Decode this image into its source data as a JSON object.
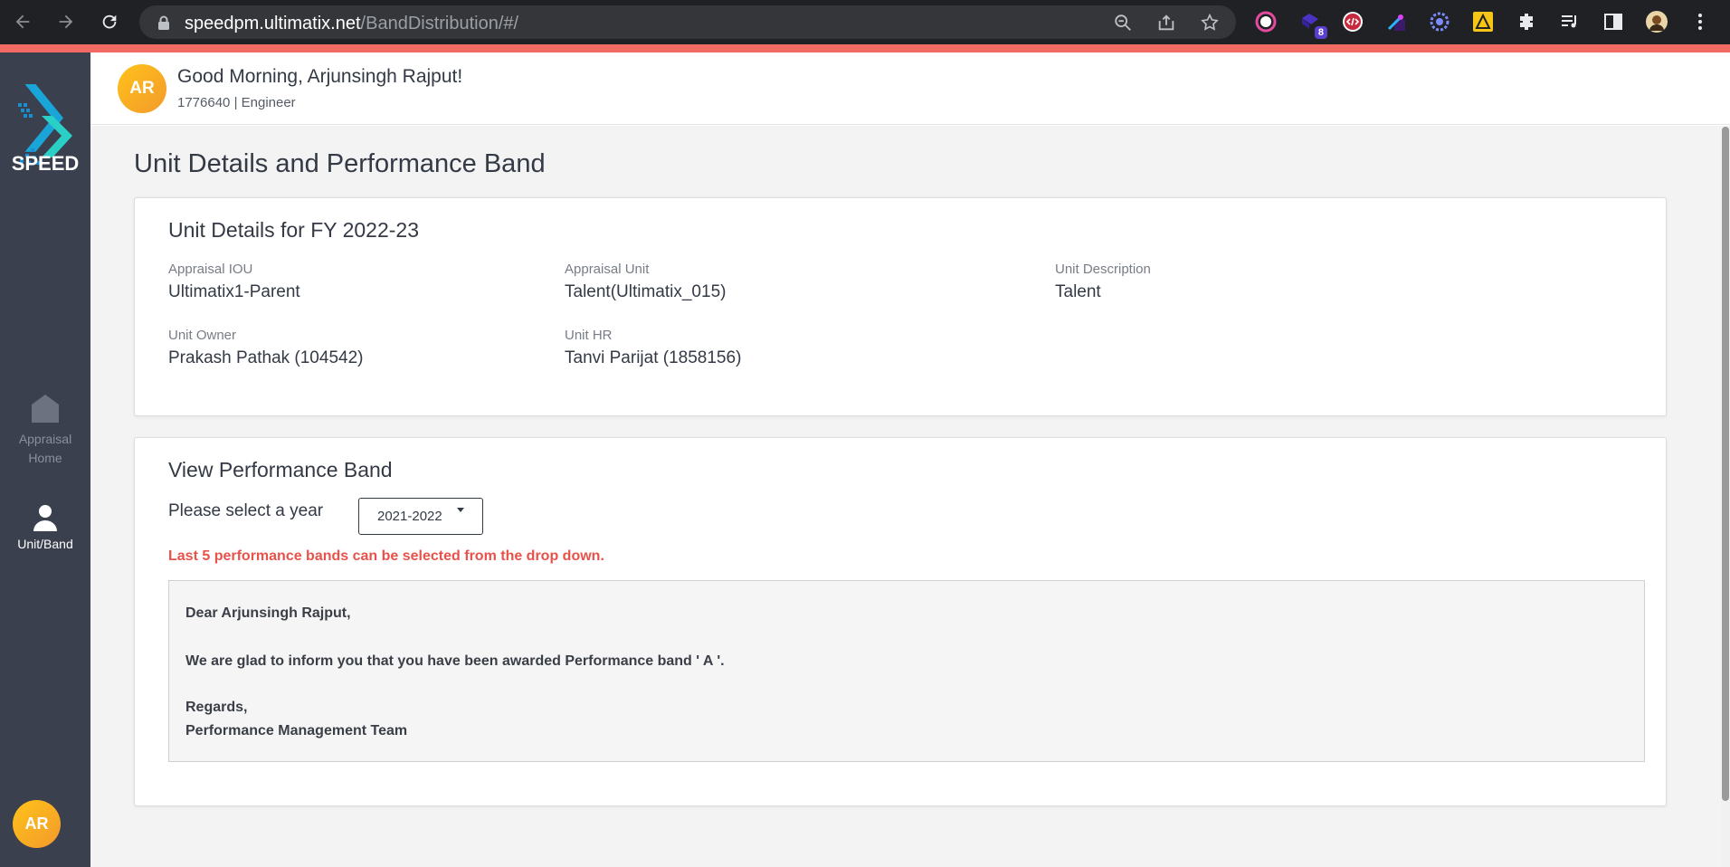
{
  "browser": {
    "url_host": "speedpm.ultimatix.net",
    "url_path": "/BandDistribution/#/",
    "extension_badge": "8"
  },
  "sidebar": {
    "logo_text": "SPEED",
    "items": [
      {
        "label_line1": "Appraisal",
        "label_line2": "Home",
        "icon": "home-icon"
      },
      {
        "label": "Unit/Band",
        "icon": "user-icon"
      }
    ],
    "avatar_initials": "AR"
  },
  "header": {
    "avatar_initials": "AR",
    "greeting": "Good Morning, Arjunsingh Rajput!",
    "subline": "1776640 | Engineer"
  },
  "page": {
    "title": "Unit Details and Performance Band"
  },
  "unit_details": {
    "title": "Unit Details for FY 2022-23",
    "fields": [
      {
        "label": "Appraisal IOU",
        "value": "Ultimatix1-Parent"
      },
      {
        "label": "Appraisal Unit",
        "value": "Talent(Ultimatix_015)"
      },
      {
        "label": "Unit Description",
        "value": "Talent"
      },
      {
        "label": "Unit Owner",
        "value": "Prakash Pathak (104542)"
      },
      {
        "label": "Unit HR",
        "value": "Tanvi Parijat (1858156)"
      }
    ]
  },
  "performance_band": {
    "title": "View Performance Band",
    "year_label": "Please select a year",
    "selected_year": "2021-2022",
    "note": "Last 5 performance bands can be selected from the drop down.",
    "message": {
      "salutation": "Dear Arjunsingh Rajput,",
      "body": "We are glad to inform you that you have been awarded Performance band ' A '.",
      "closing": "Regards,",
      "signature": "Performance Management Team"
    }
  },
  "colors": {
    "sidebar_bg": "#3b404f",
    "accent_red": "#e8524b",
    "avatar_gradient_start": "#ffc21a",
    "avatar_gradient_end": "#f39a2b",
    "browser_bg": "#202124"
  }
}
